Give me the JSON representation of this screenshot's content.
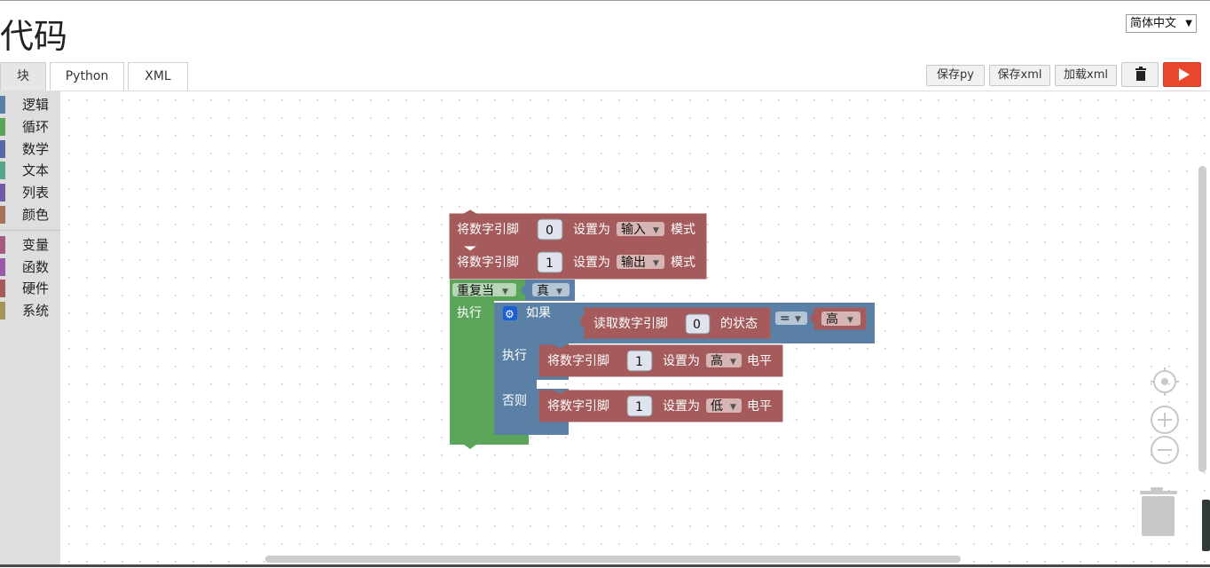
{
  "page": {
    "title": "代码"
  },
  "language": {
    "selected": "简体中文",
    "arrow": "▼"
  },
  "tabs": [
    {
      "label": "块"
    },
    {
      "label": "Python"
    },
    {
      "label": "XML"
    }
  ],
  "toolbar": {
    "save_py_label": "保存py",
    "save_xml_label": "保存xml",
    "load_xml_label": "加载xml",
    "delete_icon": "trash-icon",
    "run_icon": "play-icon",
    "run_color": "#e8482d"
  },
  "toolbox": {
    "categories": [
      {
        "label": "逻辑",
        "color": "#5b80a5"
      },
      {
        "label": "循环",
        "color": "#5ba55b"
      },
      {
        "label": "数学",
        "color": "#5b67a5"
      },
      {
        "label": "文本",
        "color": "#5ba58c"
      },
      {
        "label": "列表",
        "color": "#745ba5"
      },
      {
        "label": "颜色",
        "color": "#a5745b"
      },
      {
        "label": "变量",
        "color": "#a55b80"
      },
      {
        "label": "函数",
        "color": "#995ba5"
      },
      {
        "label": "硬件",
        "color": "#a55b5b"
      },
      {
        "label": "系统",
        "color": "#a5955b"
      }
    ]
  },
  "blocks": {
    "colors": {
      "hardware": "#a55b5b",
      "loop": "#5ba55b",
      "logic": "#5b80a5"
    },
    "pin_mode_1": {
      "prefix": "将数字引脚",
      "pin": "0",
      "middle": "设置为",
      "mode": "输入",
      "suffix": "模式"
    },
    "pin_mode_2": {
      "prefix": "将数字引脚",
      "pin": "1",
      "middle": "设置为",
      "mode": "输出",
      "suffix": "模式"
    },
    "while_loop": {
      "label": "重复当",
      "condition": "真",
      "do_label": "执行"
    },
    "if_block": {
      "if_label": "如果",
      "do_label": "执行",
      "else_label": "否则"
    },
    "read_pin": {
      "prefix": "读取数字引脚",
      "pin": "0",
      "suffix": "的状态"
    },
    "compare": {
      "operator": "=",
      "value": "高"
    },
    "write_high": {
      "prefix": "将数字引脚",
      "pin": "1",
      "middle": "设置为",
      "level": "高",
      "suffix": "电平"
    },
    "write_low": {
      "prefix": "将数字引脚",
      "pin": "1",
      "middle": "设置为",
      "level": "低",
      "suffix": "电平"
    }
  },
  "workspace_controls": {
    "recenter_icon": "target-icon",
    "zoom_in_icon": "zoom-in-icon",
    "zoom_out_icon": "zoom-out-icon",
    "trashcan_icon": "trashcan-icon"
  }
}
